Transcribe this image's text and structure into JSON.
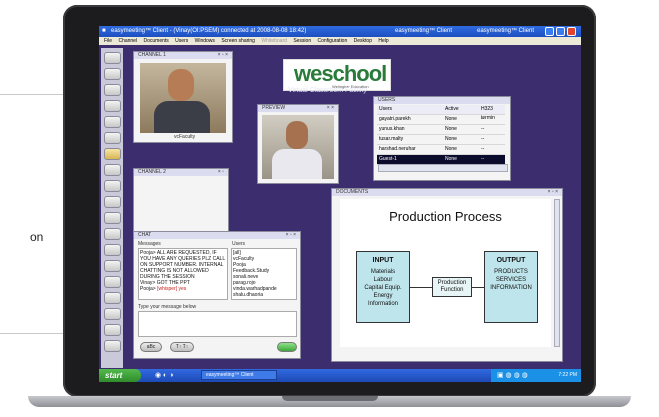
{
  "background": {
    "side_text": "on"
  },
  "window": {
    "title": "easymeeting™ Client - (Vinay(OI:PSEM) connected at 2008-08-08 18:42)",
    "title_right": "easymeeting™ Client",
    "title_right2": "easymeeting™ Client"
  },
  "menu": [
    "File",
    "Channel",
    "Documents",
    "Users",
    "Windows",
    "Screen sharing",
    "Whiteboard",
    "Session",
    "Configuration",
    "Desktop",
    "Help"
  ],
  "channel1": {
    "title": "CHANNEL 1",
    "caption": "vcFaculty"
  },
  "channel2": {
    "title": "CHANNEL 2"
  },
  "preview": {
    "title": "PREVIEW"
  },
  "logo": {
    "text": "weschool",
    "sub": "Welingkar Education",
    "tagline": "Virtual Classroom Facility"
  },
  "users": {
    "title": "USERS",
    "columns": [
      "Users",
      "Active",
      "H323 termin"
    ],
    "rows": [
      {
        "name": "gayatri.parekh",
        "active": "None",
        "h323": "--"
      },
      {
        "name": "yunus.khan",
        "active": "None",
        "h323": "--"
      },
      {
        "name": "tusar.malty",
        "active": "None",
        "h323": "--"
      },
      {
        "name": "harshad.neruhar",
        "active": "None",
        "h323": "--"
      },
      {
        "name": "Guest-1",
        "active": "None",
        "h323": "--"
      }
    ]
  },
  "chat": {
    "title": "CHAT",
    "messages_label": "Messages",
    "users_label": "Users",
    "messages": [
      "Pooja> ALL ARE REQUESTED, IF",
      "YOU HAVE ANY QUERIES PLZ CALL",
      "ON SUPPORT NUMBER. INTERNAL",
      "CHATTING IS NOT ALLOWED",
      "DURING THE SESSION",
      "Vinay> GOT THE PPT"
    ],
    "last_message_prefix": "Pooja> ",
    "last_message_red": "[whisper] yes",
    "user_list": [
      "[all]",
      "vcFaculty",
      "Pooja",
      "Feedback.Study",
      "sonali.neve",
      "parag.rojo",
      "vinda.warhadpande",
      "shalu.dhaoria"
    ],
    "input_label": "Type your message below",
    "btn_left": "aBc",
    "btn_mid": "T↑ T↑"
  },
  "documents": {
    "title": "DOCUMENTS",
    "slide_title": "Production  Process",
    "input_box": {
      "heading": "INPUT",
      "lines": [
        "Materials",
        "Labour",
        "Capital Equip.",
        "Energy",
        "Information"
      ]
    },
    "function_box": {
      "lines": [
        "Production",
        "Function"
      ]
    },
    "output_box": {
      "heading": "OUTPUT",
      "lines": [
        "PRODUCTS",
        "SERVICES",
        "INFORMATION"
      ]
    }
  },
  "taskbar": {
    "start": "start",
    "task_label": "easymeeting™ Client",
    "clock": "7:22 PM"
  }
}
